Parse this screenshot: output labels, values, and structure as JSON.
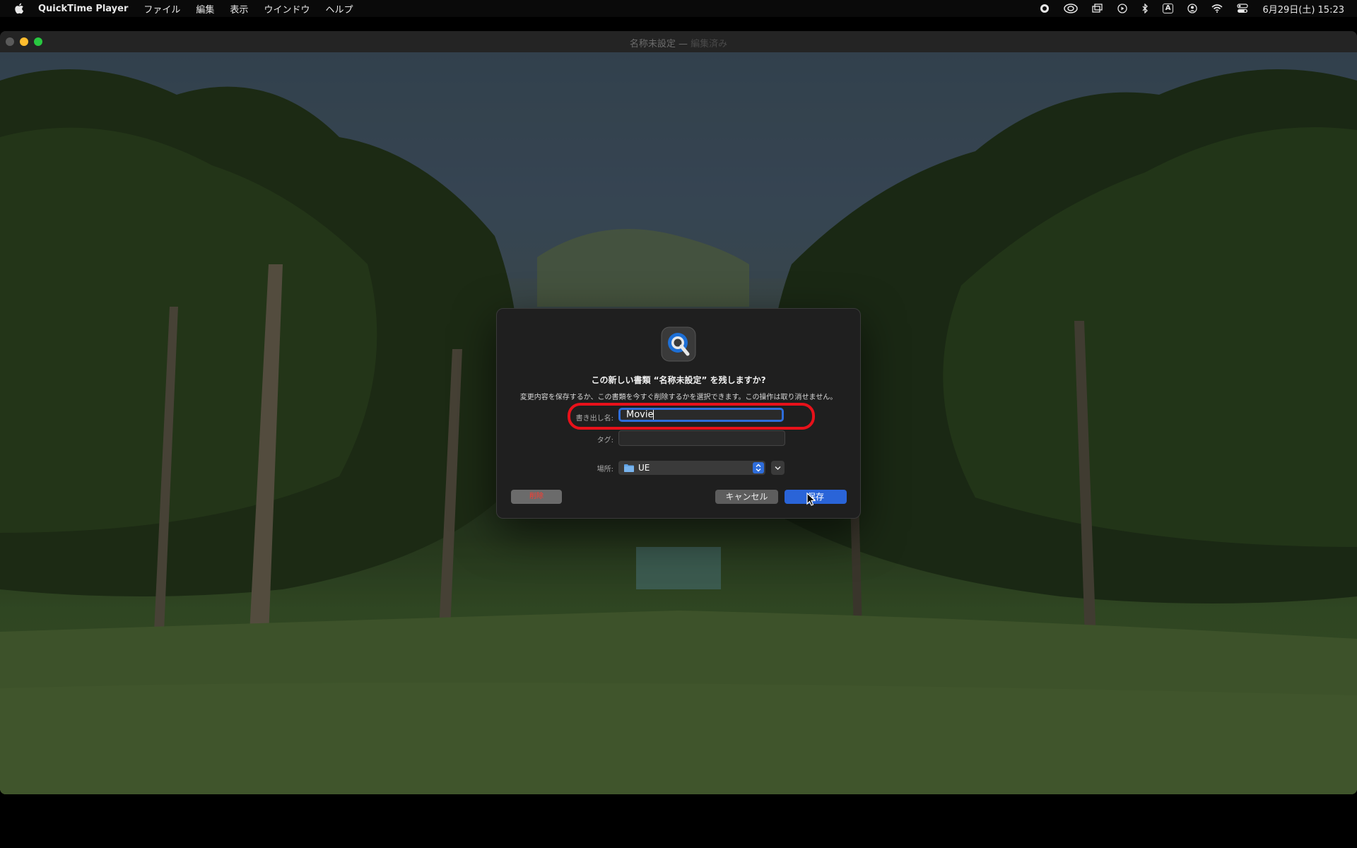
{
  "menubar": {
    "app_name": "QuickTime Player",
    "items": [
      "ファイル",
      "編集",
      "表示",
      "ウインドウ",
      "ヘルプ"
    ],
    "input_method": "A",
    "clock": "6月29日(土) 15:23"
  },
  "window": {
    "title": "名称未設定",
    "title_separator": " — ",
    "title_status": "編集済み"
  },
  "dialog": {
    "title": "この新しい書類 “名称未設定” を残しますか?",
    "message": "変更内容を保存するか、この書類を今すぐ削除するかを選択できます。この操作は取り消せません。",
    "export_label": "書き出し名:",
    "export_value": "Movie",
    "tags_label": "タグ:",
    "tags_value": "",
    "location_label": "場所:",
    "location_value": "UE",
    "delete_label": "削除",
    "cancel_label": "キャンセル",
    "save_label": "保存"
  },
  "colors": {
    "accent": "#2a64d8",
    "highlight": "#e8111a",
    "delete_text": "#ff3b30"
  }
}
